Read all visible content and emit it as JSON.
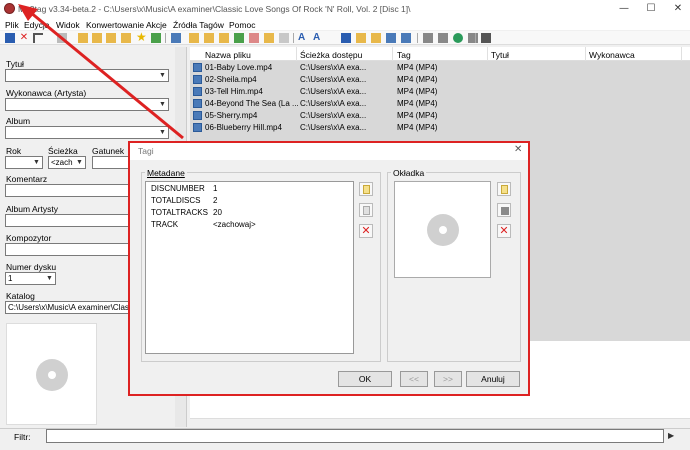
{
  "app": {
    "title": "Mp3tag v3.34-beta.2  -  C:\\Users\\x\\Music\\A examiner\\Classic Love Songs Of Rock 'N' Roll, Vol. 2 [Disc 1]\\",
    "minimize": "—",
    "maximize": "☐",
    "close": "✕"
  },
  "menu": [
    "Plik",
    "Edycja",
    "Widok",
    "Konwertowanie",
    "Akcje",
    "Źródła Tagów",
    "Pomoc"
  ],
  "left_panel": {
    "title_label": "Tytuł",
    "artist_label": "Wykonawca (Artysta)",
    "album_label": "Album",
    "year_label": "Rok",
    "track_label": "Ścieżka",
    "track_value": "<zach",
    "genre_label": "Gatunek",
    "comment_label": "Komentarz",
    "album_artist_label": "Album Artysty",
    "composer_label": "Kompozytor",
    "disc_label": "Numer dysku",
    "disc_value": "1",
    "directory_label": "Katalog",
    "directory_value": "C:\\Users\\x\\Music\\A examiner\\Classic"
  },
  "file_list": {
    "columns": [
      "Nazwa pliku",
      "Ścieżka dostępu",
      "Tag",
      "Tytuł",
      "Wykonawca"
    ],
    "rows": [
      {
        "name": "01-Baby Love.mp4",
        "path": "C:\\Users\\x\\A exa...",
        "tag": "MP4 (MP4)"
      },
      {
        "name": "02-Sheila.mp4",
        "path": "C:\\Users\\x\\A exa...",
        "tag": "MP4 (MP4)"
      },
      {
        "name": "03-Tell Him.mp4",
        "path": "C:\\Users\\x\\A exa...",
        "tag": "MP4 (MP4)"
      },
      {
        "name": "04-Beyond The Sea (La ...",
        "path": "C:\\Users\\x\\A exa...",
        "tag": "MP4 (MP4)"
      },
      {
        "name": "05-Sherry.mp4",
        "path": "C:\\Users\\x\\A exa...",
        "tag": "MP4 (MP4)"
      },
      {
        "name": "06-Blueberry Hill.mp4",
        "path": "C:\\Users\\x\\A exa...",
        "tag": "MP4 (MP4)"
      }
    ]
  },
  "filter": {
    "label": "Filtr:",
    "value": ""
  },
  "dialog": {
    "title": "Tagi",
    "close": "✕",
    "metadata_label": "Metadane",
    "cover_label": "Okładka",
    "metadata": [
      {
        "key": "DISCNUMBER",
        "value": "1"
      },
      {
        "key": "TOTALDISCS",
        "value": "2"
      },
      {
        "key": "TOTALTRACKS",
        "value": "20"
      },
      {
        "key": "TRACK",
        "value": "<zachowaj>"
      }
    ],
    "ok": "OK",
    "prev": "<<",
    "next": ">>",
    "cancel": "Anuluj"
  },
  "colors": {
    "accent_red": "#dd2222",
    "selection_gray": "#d8d8d8"
  }
}
